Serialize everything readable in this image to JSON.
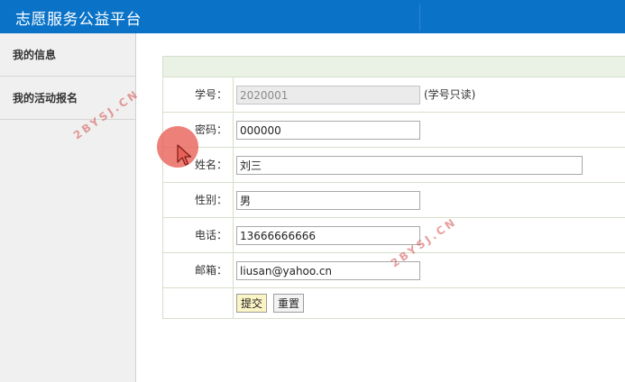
{
  "app": {
    "title": "志愿服务公益平台"
  },
  "sidebar": {
    "items": [
      {
        "label": "我的信息"
      },
      {
        "label": "我的活动报名"
      }
    ]
  },
  "form": {
    "fields": {
      "student_id": {
        "label": "学号：",
        "value": "2020001",
        "note": "(学号只读)"
      },
      "password": {
        "label": "密码：",
        "value": "000000"
      },
      "name": {
        "label": "姓名：",
        "value": "刘三"
      },
      "gender": {
        "label": "性别：",
        "value": "男"
      },
      "phone": {
        "label": "电话：",
        "value": "13666666666"
      },
      "email": {
        "label": "邮箱：",
        "value": "liusan@yahoo.cn"
      }
    },
    "submit_label": "提交",
    "reset_label": "重置"
  },
  "watermarks": [
    "2BYSJ.CN",
    "2BYSJ.CN"
  ],
  "colors": {
    "header": "#0a73c8",
    "sidebar": "#f0f0f0",
    "form_header": "#eaf2e6",
    "submit_button": "#fbf4c4",
    "cursor_highlight": "#e86058"
  }
}
